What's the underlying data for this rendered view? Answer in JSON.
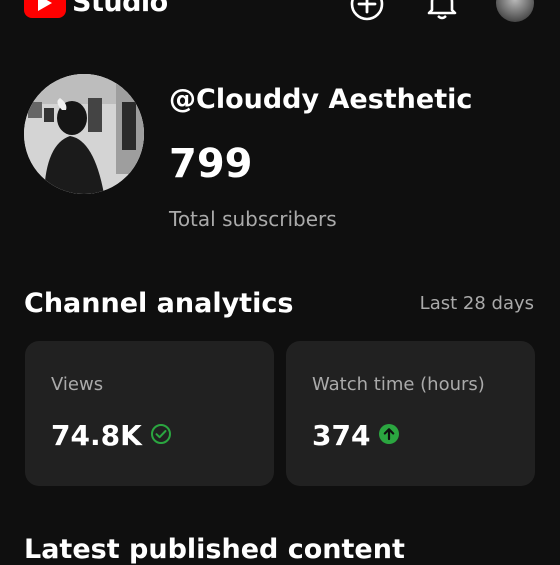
{
  "header": {
    "app_name": "Studio",
    "icons": [
      "create-icon",
      "notifications-icon",
      "account-avatar"
    ],
    "accent_color": "#ff0000",
    "notification_dot_color": "#ff0000"
  },
  "channel": {
    "handle": "@Clouddy Aesthetic",
    "subscriber_count": "799",
    "subscriber_label": "Total subscribers"
  },
  "analytics": {
    "title": "Channel analytics",
    "range": "Last 28 days",
    "cards": [
      {
        "label": "Views",
        "value": "74.8K",
        "status_icon": "check-circle-icon",
        "status_color": "#2ba640"
      },
      {
        "label": "Watch time (hours)",
        "value": "374",
        "status_icon": "arrow-up-circle-icon",
        "status_color": "#2ba640"
      }
    ]
  },
  "latest": {
    "title": "Latest published content"
  }
}
